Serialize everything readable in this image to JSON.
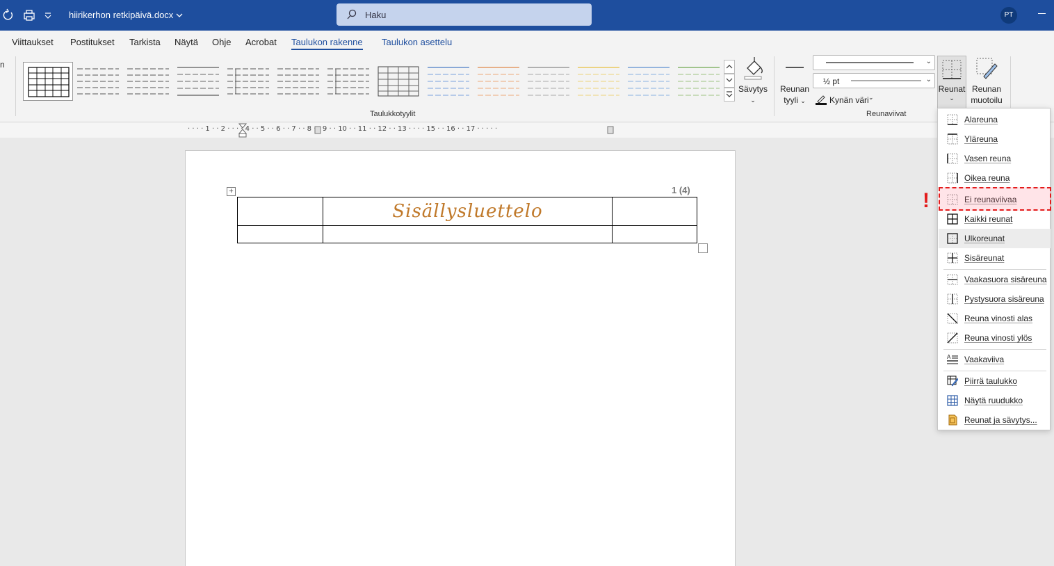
{
  "titlebar": {
    "doc_title": "hiirikerhon retkipäivä.docx",
    "search_placeholder": "Haku",
    "avatar_initials": "PT"
  },
  "tabs": [
    {
      "label": "Viittaukset"
    },
    {
      "label": "Postitukset"
    },
    {
      "label": "Tarkista"
    },
    {
      "label": "Näytä"
    },
    {
      "label": "Ohje"
    },
    {
      "label": "Acrobat"
    },
    {
      "label": "Taulukon rakenne",
      "active": true
    },
    {
      "label": "Taulukon asettelu"
    }
  ],
  "ribbon": {
    "left_cutoff": "n",
    "table_styles_label": "Taulukkotyylit",
    "shading_label": "Sävytys",
    "border_style_label": "Reunan",
    "border_style_label2": "tyyli",
    "pen_weight": "½ pt",
    "pen_color_label": "Kynän väri",
    "borders_label": "Reunat",
    "border_painter_label": "Reunan",
    "border_painter_label2": "muotoilu",
    "borders_group_label": "Reunaviivat"
  },
  "ruler": {
    "marks": "· ·  ·  · 1 ·  · 2 ·  ·  ·  · 4 ·  · 5 ·  · 6 ·  · 7 ·  · 8 ·  · 9 ·  · 10 ·  · 11 ·  · 12 ·  · 13 ·  ·  ·  · 15 ·  · 16 ·  · 17 ·  ·  ·  ·  ·"
  },
  "document": {
    "page_number": "1 (4)",
    "heading": "Sisällysluettelo"
  },
  "borders_menu": {
    "items": [
      {
        "label": "Alareuna",
        "icon": "bottom-border-icon"
      },
      {
        "label": "Yläreuna",
        "icon": "top-border-icon"
      },
      {
        "label": "Vasen reuna",
        "icon": "left-border-icon"
      },
      {
        "label": "Oikea reuna",
        "icon": "right-border-icon"
      },
      {
        "label": "Ei reunaviivaa",
        "icon": "no-border-icon"
      },
      {
        "label": "Kaikki reunat",
        "icon": "all-borders-icon"
      },
      {
        "label": "Ulkoreunat",
        "icon": "outside-borders-icon"
      },
      {
        "label": "Sisäreunat",
        "icon": "inside-borders-icon"
      },
      {
        "label": "Vaakasuora sisäreuna",
        "icon": "inside-horizontal-border-icon"
      },
      {
        "label": "Pystysuora sisäreuna",
        "icon": "inside-vertical-border-icon"
      },
      {
        "label": "Reuna vinosti alas",
        "icon": "diagonal-down-border-icon"
      },
      {
        "label": "Reuna vinosti ylös",
        "icon": "diagonal-up-border-icon"
      },
      {
        "label": "Vaakaviiva",
        "icon": "horizontal-line-icon"
      },
      {
        "label": "Piirrä taulukko",
        "icon": "draw-table-icon"
      },
      {
        "label": "Näytä ruudukko",
        "icon": "view-gridlines-icon"
      },
      {
        "label": "Reunat ja sävytys...",
        "icon": "borders-and-shading-icon"
      }
    ]
  },
  "annotation": {
    "marker": "!"
  },
  "colors": {
    "titlebar": "#1e4e9e",
    "accent": "#1e4e9e",
    "heading": "#c0792a",
    "highlight": "#e31b1b"
  }
}
